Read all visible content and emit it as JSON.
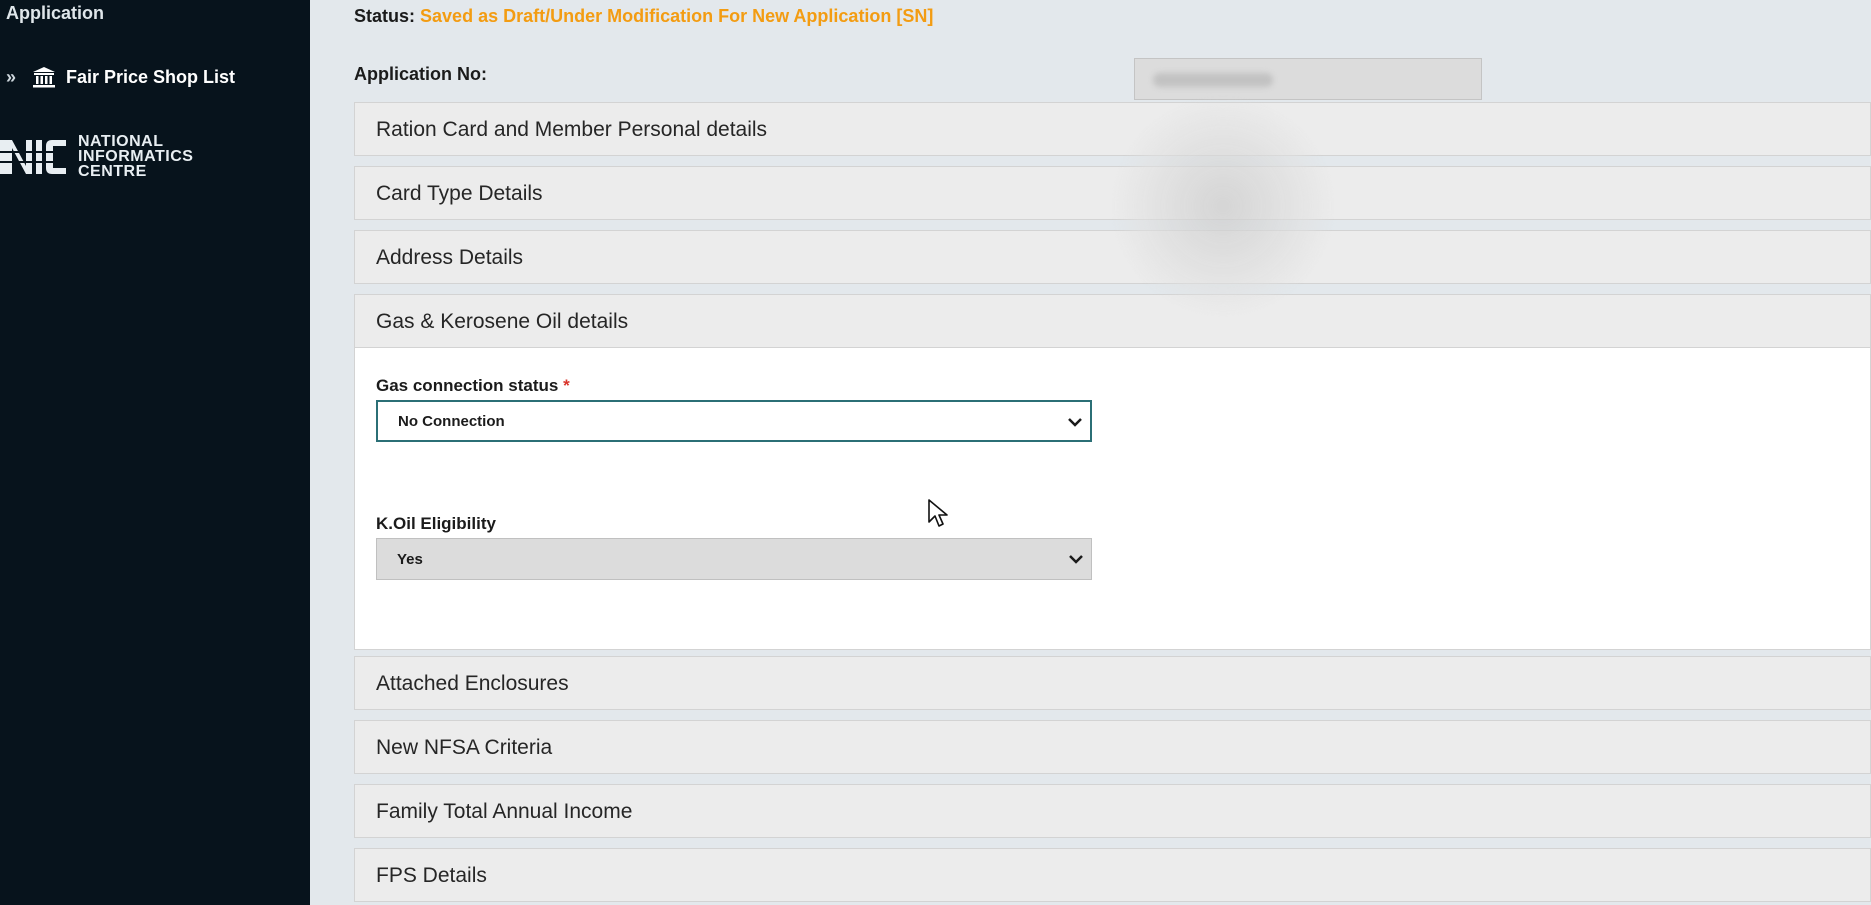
{
  "sidebar": {
    "title": "Application",
    "items": [
      {
        "label": "Fair Price Shop List",
        "icon": "bank-icon"
      }
    ],
    "logo": {
      "lines": [
        "NATIONAL",
        "INFORMATICS",
        "CENTRE"
      ]
    }
  },
  "main": {
    "status_label": "Status:",
    "status_value": "Saved as Draft/Under Modification For New Application [SN]",
    "application_no_label": "Application No:",
    "panels": [
      {
        "title": "Ration Card and Member Personal details"
      },
      {
        "title": "Card Type Details"
      },
      {
        "title": "Address Details"
      },
      {
        "title": "Gas & Kerosene Oil details"
      },
      {
        "title": "Attached Enclosures"
      },
      {
        "title": "New NFSA Criteria"
      },
      {
        "title": "Family Total Annual Income"
      },
      {
        "title": "FPS Details"
      }
    ],
    "gas_section": {
      "gas_connection_label": "Gas connection status",
      "required_mark": "*",
      "gas_connection_value": "No Connection",
      "koil_label": "K.Oil Eligibility",
      "koil_value": "Yes"
    }
  },
  "colors": {
    "sidebar_bg": "#07131c",
    "status_accent": "#f39c12",
    "active_border": "#2b6f76"
  }
}
